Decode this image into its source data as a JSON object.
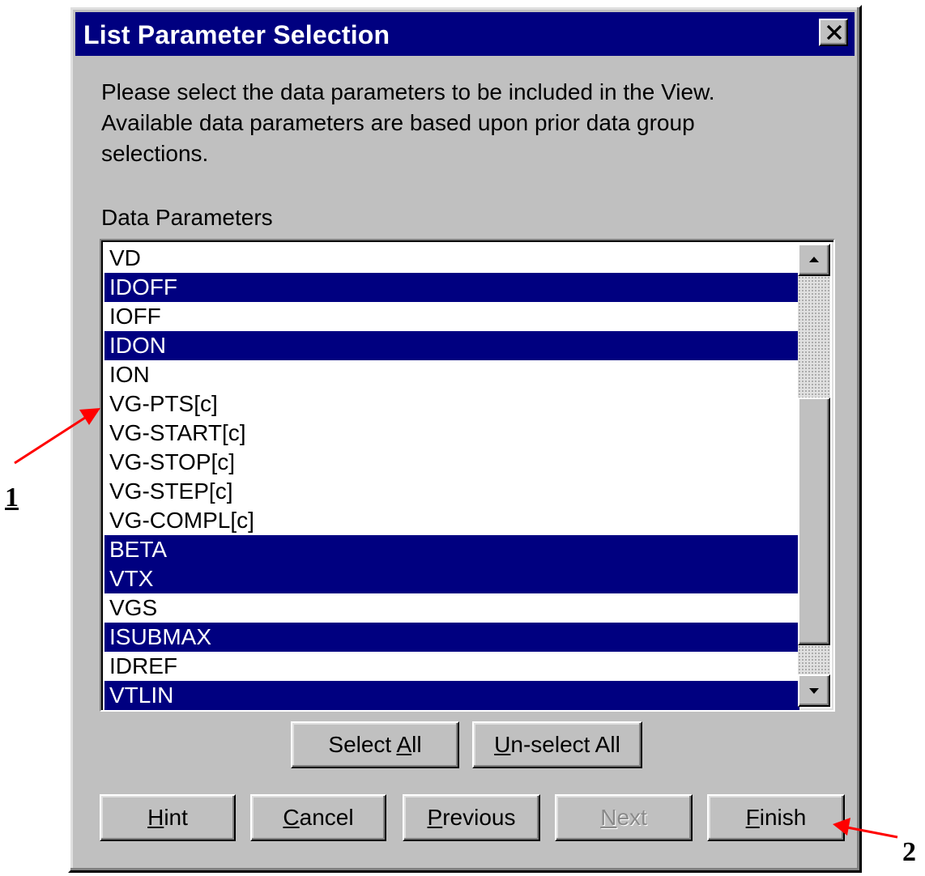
{
  "dialog": {
    "title": "List Parameter Selection",
    "instructions": "Please select the data parameters to be included in the View. Available data parameters are based upon prior data group selections.",
    "list_label": "Data Parameters"
  },
  "colors": {
    "face": "#c0c0c0",
    "title_bar": "#000080",
    "selection": "#000080",
    "annotation_arrow": "#ff0000"
  },
  "parameters": [
    {
      "label": "VD",
      "selected": false
    },
    {
      "label": "IDOFF",
      "selected": true
    },
    {
      "label": "IOFF",
      "selected": false
    },
    {
      "label": "IDON",
      "selected": true
    },
    {
      "label": "ION",
      "selected": false
    },
    {
      "label": "VG-PTS[c]",
      "selected": false
    },
    {
      "label": "VG-START[c]",
      "selected": false
    },
    {
      "label": "VG-STOP[c]",
      "selected": false
    },
    {
      "label": "VG-STEP[c]",
      "selected": false
    },
    {
      "label": "VG-COMPL[c]",
      "selected": false
    },
    {
      "label": "BETA",
      "selected": true
    },
    {
      "label": "VTX",
      "selected": true
    },
    {
      "label": "VGS",
      "selected": false
    },
    {
      "label": "ISUBMAX",
      "selected": true
    },
    {
      "label": "IDREF",
      "selected": false
    },
    {
      "label": "VTLIN",
      "selected": true
    }
  ],
  "buttons": {
    "select_all": {
      "label_before": "Select ",
      "mnemonic": "A",
      "label_after": "ll"
    },
    "unselect_all": {
      "label_before": "",
      "mnemonic": "U",
      "label_after": "n-select All"
    },
    "hint": {
      "label_before": "",
      "mnemonic": "H",
      "label_after": "int"
    },
    "cancel": {
      "label_before": "",
      "mnemonic": "C",
      "label_after": "ancel"
    },
    "previous": {
      "label_before": "",
      "mnemonic": "P",
      "label_after": "revious"
    },
    "next": {
      "label_before": "",
      "mnemonic": "N",
      "label_after": "ext",
      "enabled": false
    },
    "finish": {
      "label_before": "",
      "mnemonic": "F",
      "label_after": "inish"
    }
  },
  "annotations": {
    "callout_1": "1",
    "callout_2": "2"
  },
  "icons": {
    "close": "close-icon",
    "scroll_up": "arrow-up-icon",
    "scroll_down": "arrow-down-icon",
    "annotation": "red-arrow"
  }
}
